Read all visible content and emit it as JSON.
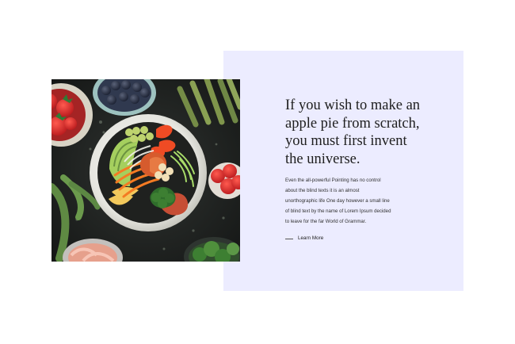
{
  "hero": {
    "headline_lines": [
      "If you wish to make an",
      "apple pie from scratch,",
      "you must first invent",
      "the universe."
    ],
    "body_lines": [
      "Even the all-powerful Pointing has no control",
      "about the blind texts it is an almost",
      "unorthographic life One day however a small line",
      "of blind text by the name of Lorem Ipsum decided",
      "to leave for the far World of Grammar."
    ],
    "cta_label": "Learn More",
    "image_subject": "food-bowl-photo"
  },
  "colors": {
    "panel_background": "#ececff",
    "heading_text": "#202020",
    "body_text": "#303030"
  }
}
